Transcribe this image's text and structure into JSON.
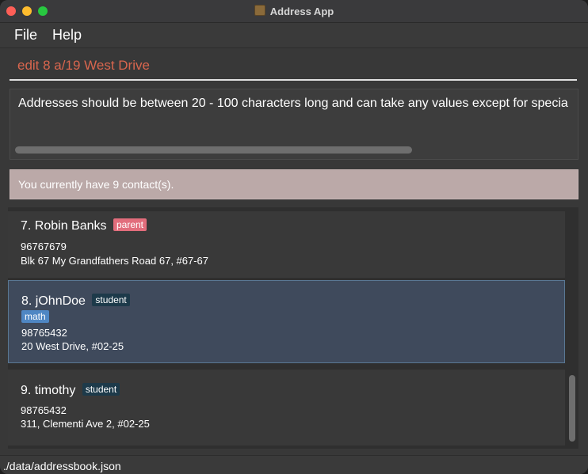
{
  "window": {
    "title": "Address App"
  },
  "menu": {
    "file": "File",
    "help": "Help"
  },
  "command": {
    "value": "edit 8 a/19 West Drive"
  },
  "result": {
    "message": "Addresses should be between 20 - 100 characters long and can take any values except for specia"
  },
  "status": {
    "message": "You currently have 9 contact(s)."
  },
  "contacts": [
    {
      "index_name": "7. Robin Banks",
      "tags": [
        "parent"
      ],
      "phone": "96767679",
      "address": "Blk 67 My Grandfathers Road 67, #67-67"
    },
    {
      "index_name": "8. jOhnDoe",
      "tags": [
        "student"
      ],
      "subject_tags": [
        "math"
      ],
      "phone": "98765432",
      "address": "20 West Drive, #02-25"
    },
    {
      "index_name": "9. timothy",
      "tags": [
        "student"
      ],
      "phone": "98765432",
      "address": "311, Clementi Ave 2, #02-25"
    }
  ],
  "footer": {
    "path": "./data/addressbook.json"
  },
  "colors": {
    "command_text": "#d9664e",
    "status_bg": "#bba9a8",
    "tag_parent": "#e26d7c",
    "tag_student": "#1d3a4a",
    "tag_math": "#4f87c4",
    "selected_card": "#3f4a5c"
  }
}
